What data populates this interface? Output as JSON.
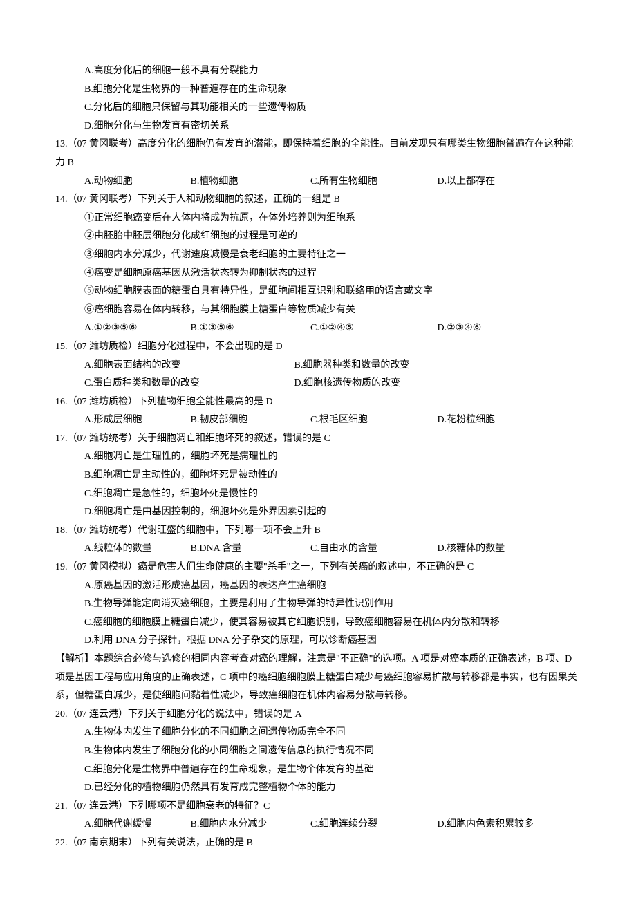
{
  "pre_options": {
    "A": "A.高度分化后的细胞一般不具有分裂能力",
    "B": "B.细胞分化是生物界的一种普遍存在的生命现象",
    "C": "C.分化后的细胞只保留与其功能相关的一些遗传物质",
    "D": "D.细胞分化与生物发育有密切关系"
  },
  "q13": {
    "stem": "13.（07 黄冈联考）高度分化的细胞仍有发育的潜能，即保持着细胞的全能性。目前发现只有哪类生物细胞普遍存在这种能力 B",
    "opts": {
      "A": "A.动物细胞",
      "B": "B.植物细胞",
      "C": "C.所有生物细胞",
      "D": "D.以上都存在"
    }
  },
  "q14": {
    "stem": "14.（07 黄冈联考）下列关于人和动物细胞的叙述，正确的一组是  B",
    "s1": "①正常细胞癌变后在人体内将成为抗原，在体外培养则为细胞系",
    "s2": "②由胚胎中胚层细胞分化成红细胞的过程是可逆的",
    "s3": "③细胞内水分减少，代谢速度减慢是衰老细胞的主要特征之一",
    "s4": "④癌变是细胞原癌基因从激活状态转为抑制状态的过程",
    "s5": "⑤动物细胞膜表面的糖蛋白具有特异性，是细胞间相互识别和联络用的语言或文字",
    "s6": "⑥癌细胞容易在体内转移，与其细胞膜上糖蛋白等物质减少有关",
    "opts": {
      "A": "A.①②③⑤⑥",
      "B": "B.①③⑤⑥",
      "C": "C.①②④⑤",
      "D": "D.②③④⑥"
    }
  },
  "q15": {
    "stem": "15.（07 潍坊质检）细胞分化过程中，不会出现的是  D",
    "opts": {
      "A": "A.细胞表面结构的改变",
      "B": "B.细胞器种类和数量的改变",
      "C": "C.蛋白质种类和数量的改变",
      "D": "D.细胞核遗传物质的改变"
    }
  },
  "q16": {
    "stem": "16.（07 潍坊质检）下列植物细胞全能性最高的是  D",
    "opts": {
      "A": "A.形成层细胞",
      "B": "B.韧皮部细胞",
      "C": "C.根毛区细胞",
      "D": "D.花粉粒细胞"
    }
  },
  "q17": {
    "stem": "17.（07 潍坊统考）关于细胞凋亡和细胞坏死的叙述，错误的是  C",
    "A": "A.细胞凋亡是生理性的，细胞坏死是病理性的",
    "B": "B.细胞凋亡是主动性的，细胞坏死是被动性的",
    "C": "C.细胞凋亡是急性的，细胞坏死是慢性的",
    "D": "D.细胞凋亡是由基因控制的，细胞坏死是外界因素引起的"
  },
  "q18": {
    "stem": "18.（07 潍坊统考）代谢旺盛的细胞中，下列哪一项不会上升   B",
    "opts": {
      "A": "A.线粒体的数量",
      "B": "B.DNA 含量",
      "C": "C.自由水的含量",
      "D": "D.核糖体的数量"
    }
  },
  "q19": {
    "stem": "19.（07 黄冈模拟）癌是危害人们生命健康的主要\"杀手\"之一，下列有关癌的叙述中，不正确的是  C",
    "A": "A.原癌基因的激活形成癌基因，癌基因的表达产生癌细胞",
    "B": "B.生物导弹能定向消灭癌细胞，主要是利用了生物导弹的特异性识别作用",
    "C": "C.癌细胞的细胞膜上糖蛋白减少，使其容易被其它细胞识别，导致癌细胞容易在机体内分散和转移",
    "D": "D.利用 DNA 分子探针，根据 DNA 分子杂交的原理，可以诊断癌基因",
    "analysis": "【解析】本题综合必修与选修的相同内容考查对癌的理解，注意是\"不正确\"的选项。A 项是对癌本质的正确表述，B 项、D 项是基因工程与应用角度的正确表述，C 项中的癌细胞细胞膜上糖蛋白减少与癌细胞容易扩散与转移都是事实，也有因果关系，但糖蛋白减少，是使细胞间黏着性减少，导致癌细胞在机体内容易分散与转移。"
  },
  "q20": {
    "stem": "20.（07 连云港）下列关于细胞分化的说法中，错误的是  A",
    "A": "A.生物体内发生了细胞分化的不同细胞之间遗传物质完全不同",
    "B": "B.生物体内发生了细胞分化的小同细胞之间遗传信息的执行情况不同",
    "C": "C.细胞分化是生物界中普遍存在的生命现象，是生物个体发育的基础",
    "D": "D.已经分化的植物细胞仍然具有发育成完整植物个体的能力"
  },
  "q21": {
    "stem": "21.（07 连云港）下列哪项不是细胞衰老的特征？C",
    "opts": {
      "A": "A.细胞代谢缓慢",
      "B": "B.细胞内水分减少",
      "C": "C.细胞连续分裂",
      "D": "D.细胞内色素积累较多"
    }
  },
  "q22": {
    "stem": "22.（07 南京期末）下列有关说法，正确的是  B"
  }
}
